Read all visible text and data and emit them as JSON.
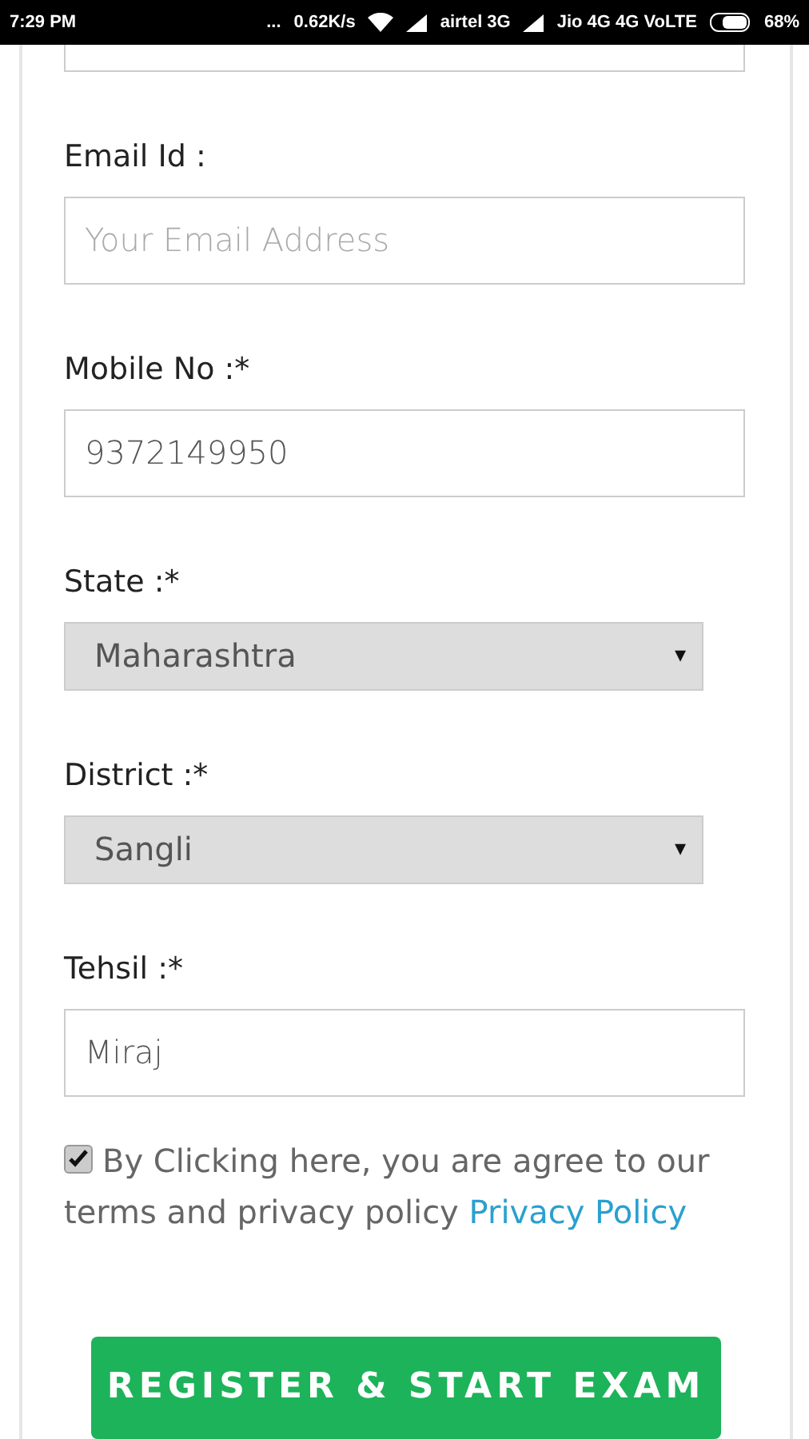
{
  "status_bar": {
    "time": "7:29 PM",
    "dots": "...",
    "speed": "0.62K/s",
    "carrier_1": "airtel 3G",
    "carrier_2": "Jio 4G 4G VoLTE",
    "battery": "68%"
  },
  "fields": [
    {
      "kind": "input",
      "label": "Email Id :",
      "placeholder": "Your Email Address"
    },
    {
      "kind": "input",
      "label": "Mobile No :*",
      "value": "9372149950"
    },
    {
      "kind": "select",
      "label": "State :*",
      "value": "Maharashtra",
      "arrow": "▾"
    },
    {
      "kind": "select",
      "label": "District :*",
      "value": "Sangli",
      "arrow": "▾"
    },
    {
      "kind": "input",
      "label": "Tehsil :*",
      "value": "Miraj"
    }
  ],
  "agreement": {
    "checked": true,
    "text": "By Clicking here, you are agree to our terms and privacy policy",
    "link": "Privacy Policy"
  },
  "submit": "REGISTER & START EXAM"
}
